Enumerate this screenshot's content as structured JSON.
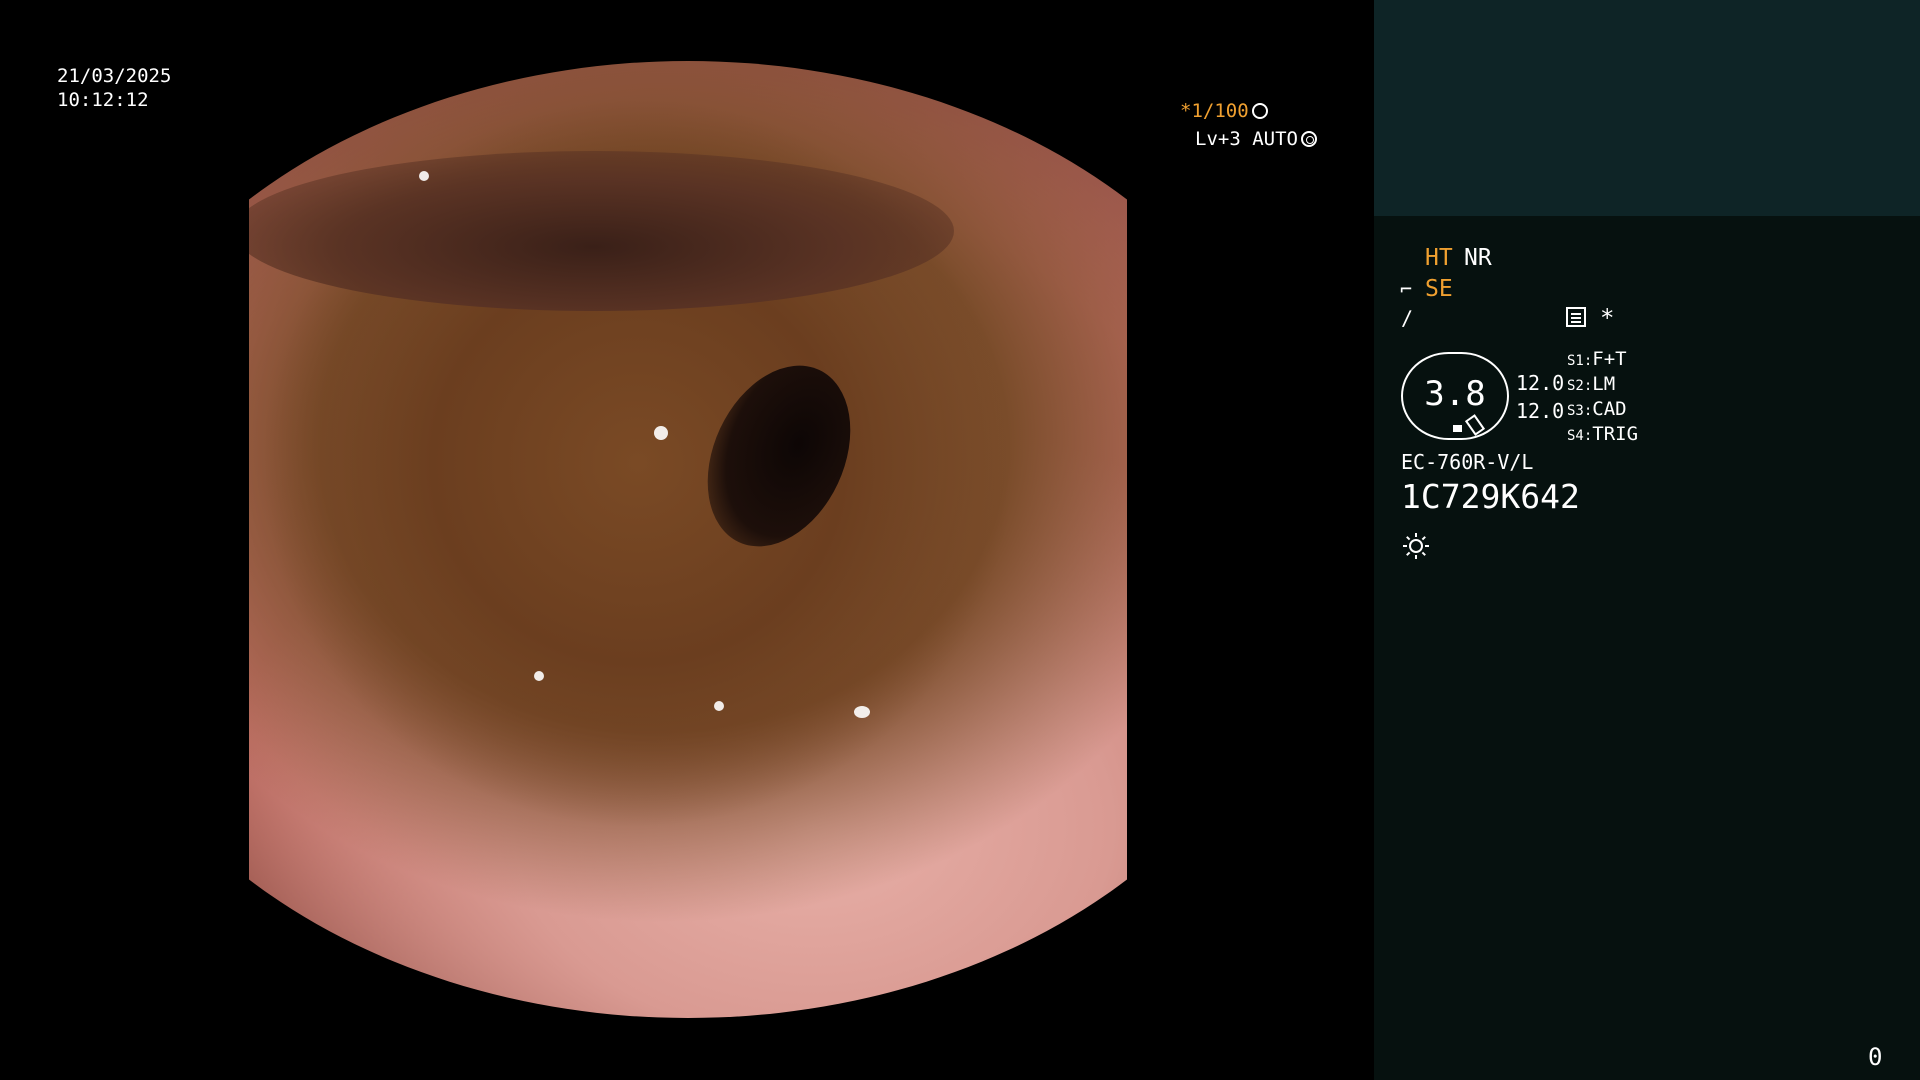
{
  "image_overlay": {
    "date": "21/03/2025",
    "time": "10:12:12",
    "shutter": "*1/100",
    "level": "Lv+3 AUTO"
  },
  "panel": {
    "mode_ht": "HT",
    "mode_nr": "NR",
    "mode_se": "SE",
    "star": "*",
    "gauge_value": "3.8",
    "value_1": "12.0",
    "value_2": "12.0",
    "switches": [
      {
        "key": "S1:",
        "value": "F+T"
      },
      {
        "key": "S2:",
        "value": "LM"
      },
      {
        "key": "S3:",
        "value": "CAD"
      },
      {
        "key": "S4:",
        "value": "TRIG"
      }
    ],
    "model": "EC-760R-V/L",
    "serial": "1C729K642"
  },
  "counter": "0",
  "colors": {
    "accent_orange": "#f0a030",
    "panel_top": "#0e2426",
    "panel_bg": "#06110f"
  },
  "icons": [
    "shutter-icon",
    "level-icon",
    "scope-icon",
    "slope-icon",
    "menu-icon",
    "brightness-icon"
  ]
}
